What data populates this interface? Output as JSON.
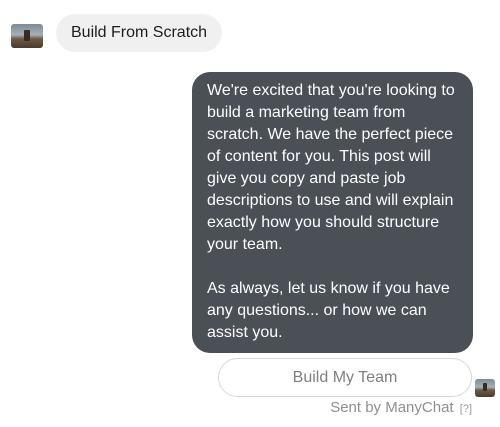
{
  "user_message": {
    "text": "Build From Scratch"
  },
  "bot_message": {
    "text": "We're excited that you're looking to build a marketing team from scratch. We have the perfect piece of content for you. This post will give you copy and paste job descriptions to use and will explain exactly how you should structure your team.\n\nAs always, let us know if you have any questions... or how we can assist you."
  },
  "quick_reply": {
    "label": "Build My Team"
  },
  "footer": {
    "sent_by": "Sent by ManyChat",
    "help": "[?]"
  },
  "colors": {
    "bot_bubble": "#4b4f56",
    "user_bubble": "#f0f0f0"
  }
}
